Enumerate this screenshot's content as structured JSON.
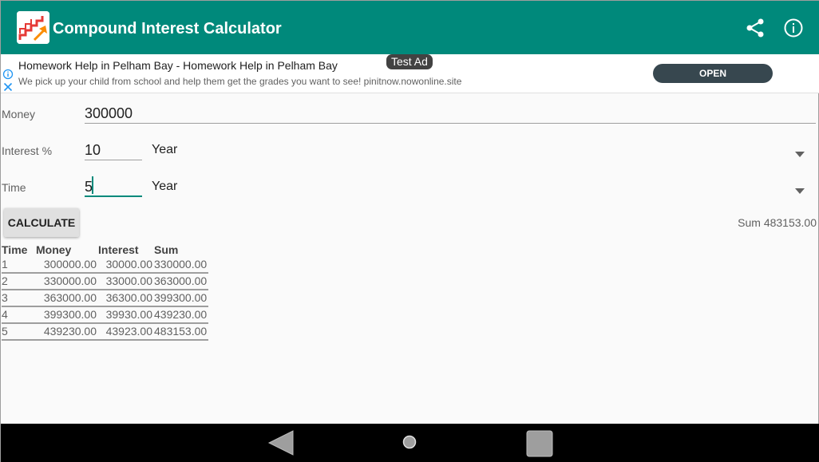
{
  "app": {
    "title": "Compound Interest Calculator",
    "accent_color": "#00897b",
    "icons": [
      "app-logo-icon",
      "share-icon",
      "info-icon"
    ]
  },
  "ad": {
    "badge": "Test Ad",
    "title": "Homework Help in Pelham Bay - Homework Help in Pelham Bay",
    "description": "We pick up your child from school and help them get the grades you want to see! pinitnow.nowonline.site",
    "cta": "OPEN"
  },
  "form": {
    "money_label": "Money",
    "money_value": "300000",
    "interest_label": "Interest %",
    "interest_value": "10",
    "interest_unit": "Year",
    "time_label": "Time",
    "time_value": "5",
    "time_unit": "Year"
  },
  "actions": {
    "calculate_label": "CALCULATE",
    "sum_text": "Sum 483153.00"
  },
  "table": {
    "headers": [
      "Time",
      "Money",
      "Interest",
      "Sum"
    ],
    "rows": [
      [
        "1",
        "300000.00",
        "30000.00",
        "330000.00"
      ],
      [
        "2",
        "330000.00",
        "33000.00",
        "363000.00"
      ],
      [
        "3",
        "363000.00",
        "36300.00",
        "399300.00"
      ],
      [
        "4",
        "399300.00",
        "39930.00",
        "439230.00"
      ],
      [
        "5",
        "439230.00",
        "43923.00",
        "483153.00"
      ]
    ]
  }
}
